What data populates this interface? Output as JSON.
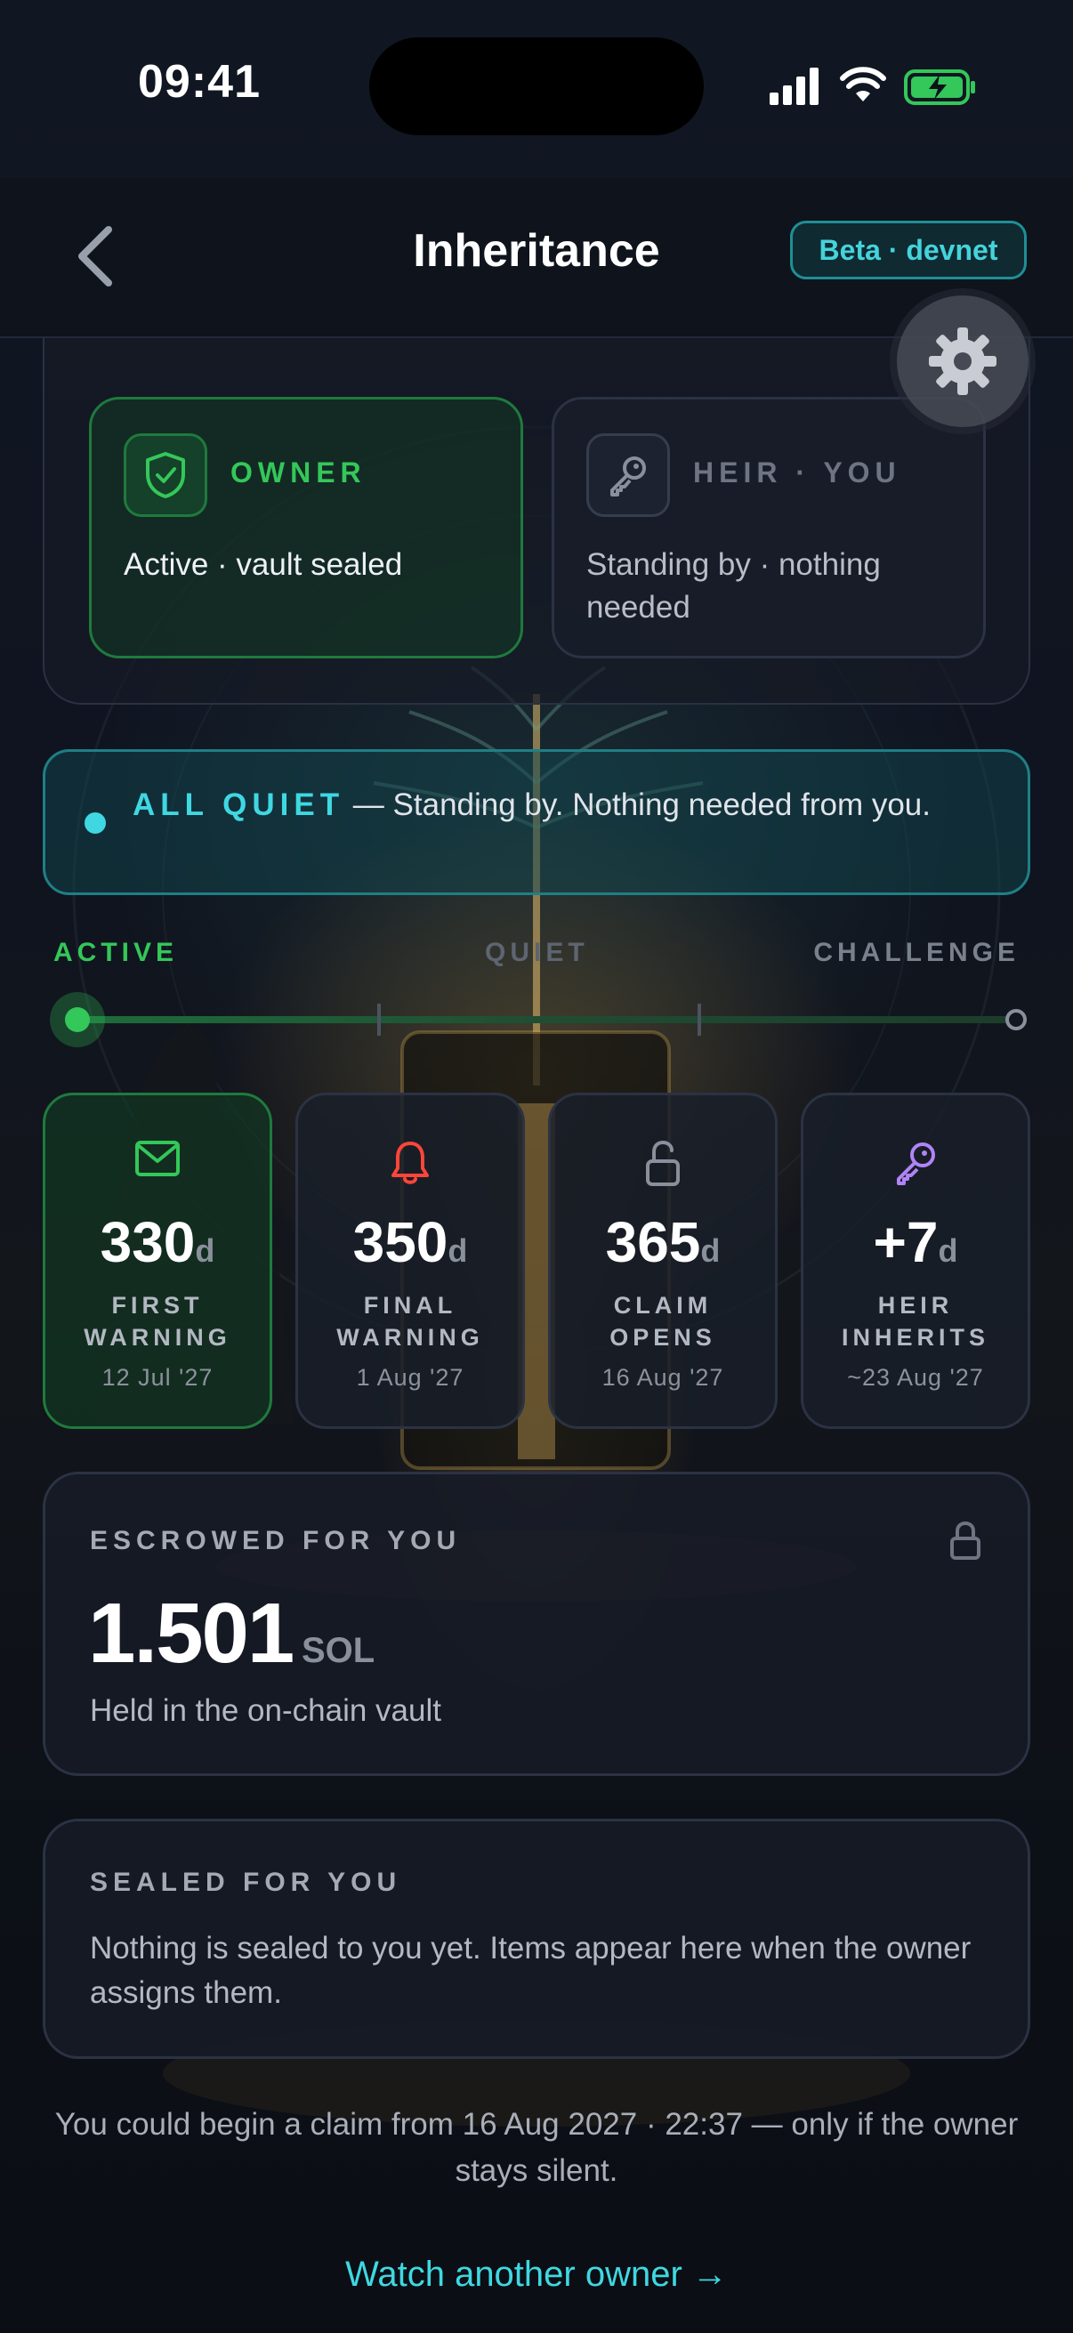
{
  "status_bar": {
    "time": "09:41"
  },
  "nav": {
    "title": "Inheritance",
    "badge": "Beta · devnet"
  },
  "roles": {
    "owner": {
      "label": "OWNER",
      "status": "Active · vault sealed"
    },
    "heir": {
      "label": "HEIR · YOU",
      "status": "Standing by · nothing needed"
    }
  },
  "banner": {
    "headline": "ALL QUIET",
    "separator": " — ",
    "message": "Standing by. Nothing needed from you."
  },
  "stages": {
    "active": "ACTIVE",
    "quiet": "QUIET",
    "challenge": "CHALLENGE",
    "progress": 0.0
  },
  "milestones": [
    {
      "icon": "envelope-icon",
      "value": "330",
      "unit": "d",
      "name": "FIRST WARNING",
      "date": "12 Jul '27",
      "color": "#34c759"
    },
    {
      "icon": "bell-icon",
      "value": "350",
      "unit": "d",
      "name": "FINAL WARNING",
      "date": "1 Aug '27",
      "color": "#ff453a"
    },
    {
      "icon": "unlock-icon",
      "value": "365",
      "unit": "d",
      "name": "CLAIM OPENS",
      "date": "16 Aug '27",
      "color": "#8a909b"
    },
    {
      "icon": "key-icon",
      "value": "+7",
      "unit": "d",
      "name": "HEIR INHERITS",
      "date": "~23 Aug '27",
      "color": "#b084f5"
    }
  ],
  "escrow": {
    "label": "ESCROWED FOR YOU",
    "amount": "1.501",
    "currency": "SOL",
    "note": "Held in the on-chain vault"
  },
  "sealed": {
    "label": "SEALED FOR YOU",
    "body": "Nothing is sealed to you yet. Items appear here when the owner assigns them."
  },
  "footer": {
    "note": "You could begin a claim from 16 Aug 2027 · 22:37 — only if the owner stays silent.",
    "link": "Watch another owner →"
  },
  "colors": {
    "accent_cyan": "#3fd8e2",
    "active_green": "#34c759",
    "background": "#0d111a"
  }
}
